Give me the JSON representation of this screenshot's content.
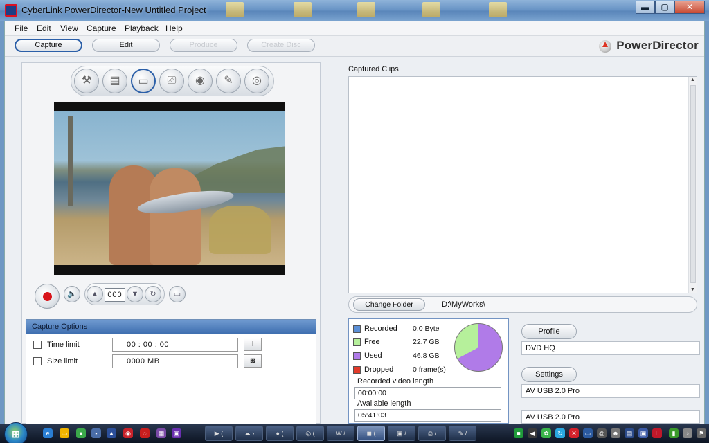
{
  "window": {
    "title": "CyberLink PowerDirector-New Untitled Project",
    "minimize": "▬",
    "maximize": "▢",
    "close": "✕"
  },
  "menu": [
    "File",
    "Edit",
    "View",
    "Capture",
    "Playback",
    "Help"
  ],
  "modes": [
    {
      "label": "Capture",
      "state": "active"
    },
    {
      "label": "Edit",
      "state": "enabled"
    },
    {
      "label": "Produce",
      "state": "disabled"
    },
    {
      "label": "Create Disc",
      "state": "disabled"
    }
  ],
  "brand": "PowerDirector",
  "capture_sources": [
    "tools-icon",
    "capture-device-icon",
    "tv-capture-icon",
    "scanner-icon",
    "webcam-icon",
    "microphone-icon",
    "disc-icon"
  ],
  "transport": {
    "counter": "000"
  },
  "capture_options": {
    "title": "Capture Options",
    "time_limit": {
      "label": "Time limit",
      "value": "00 : 00 : 00"
    },
    "size_limit": {
      "label": "Size limit",
      "value": "0000  MB"
    }
  },
  "captured_clips": {
    "title": "Captured Clips",
    "change_folder_label": "Change Folder",
    "folder_path": "D:\\MyWorks\\"
  },
  "disk": {
    "legend": [
      {
        "name": "Recorded",
        "value": "0.0  Byte",
        "color": "#5b8fd6"
      },
      {
        "name": "Free",
        "value": "22.7  GB",
        "color": "#b6f09b"
      },
      {
        "name": "Used",
        "value": "46.8  GB",
        "color": "#b07be8"
      },
      {
        "name": "Dropped",
        "value": "0 frame(s)",
        "color": "#e23a2a"
      }
    ],
    "used_fraction": 0.673,
    "recorded_length_label": "Recorded video length",
    "recorded_length": "00:00:00",
    "available_length_label": "Available length",
    "available_length": "05:41:03"
  },
  "profile": {
    "profile_label": "Profile",
    "profile_value": "DVD HQ",
    "settings_label": "Settings",
    "device_video": "AV USB 2.0 Pro",
    "device_audio": "AV USB 2.0 Pro"
  },
  "taskbar": {
    "start": "⊞",
    "tasks": [
      "▶ (",
      "☁ ›",
      "● (",
      "◎ (",
      "W /",
      "◼ (",
      "▣ /",
      "⎙ /",
      "✎ /"
    ]
  }
}
